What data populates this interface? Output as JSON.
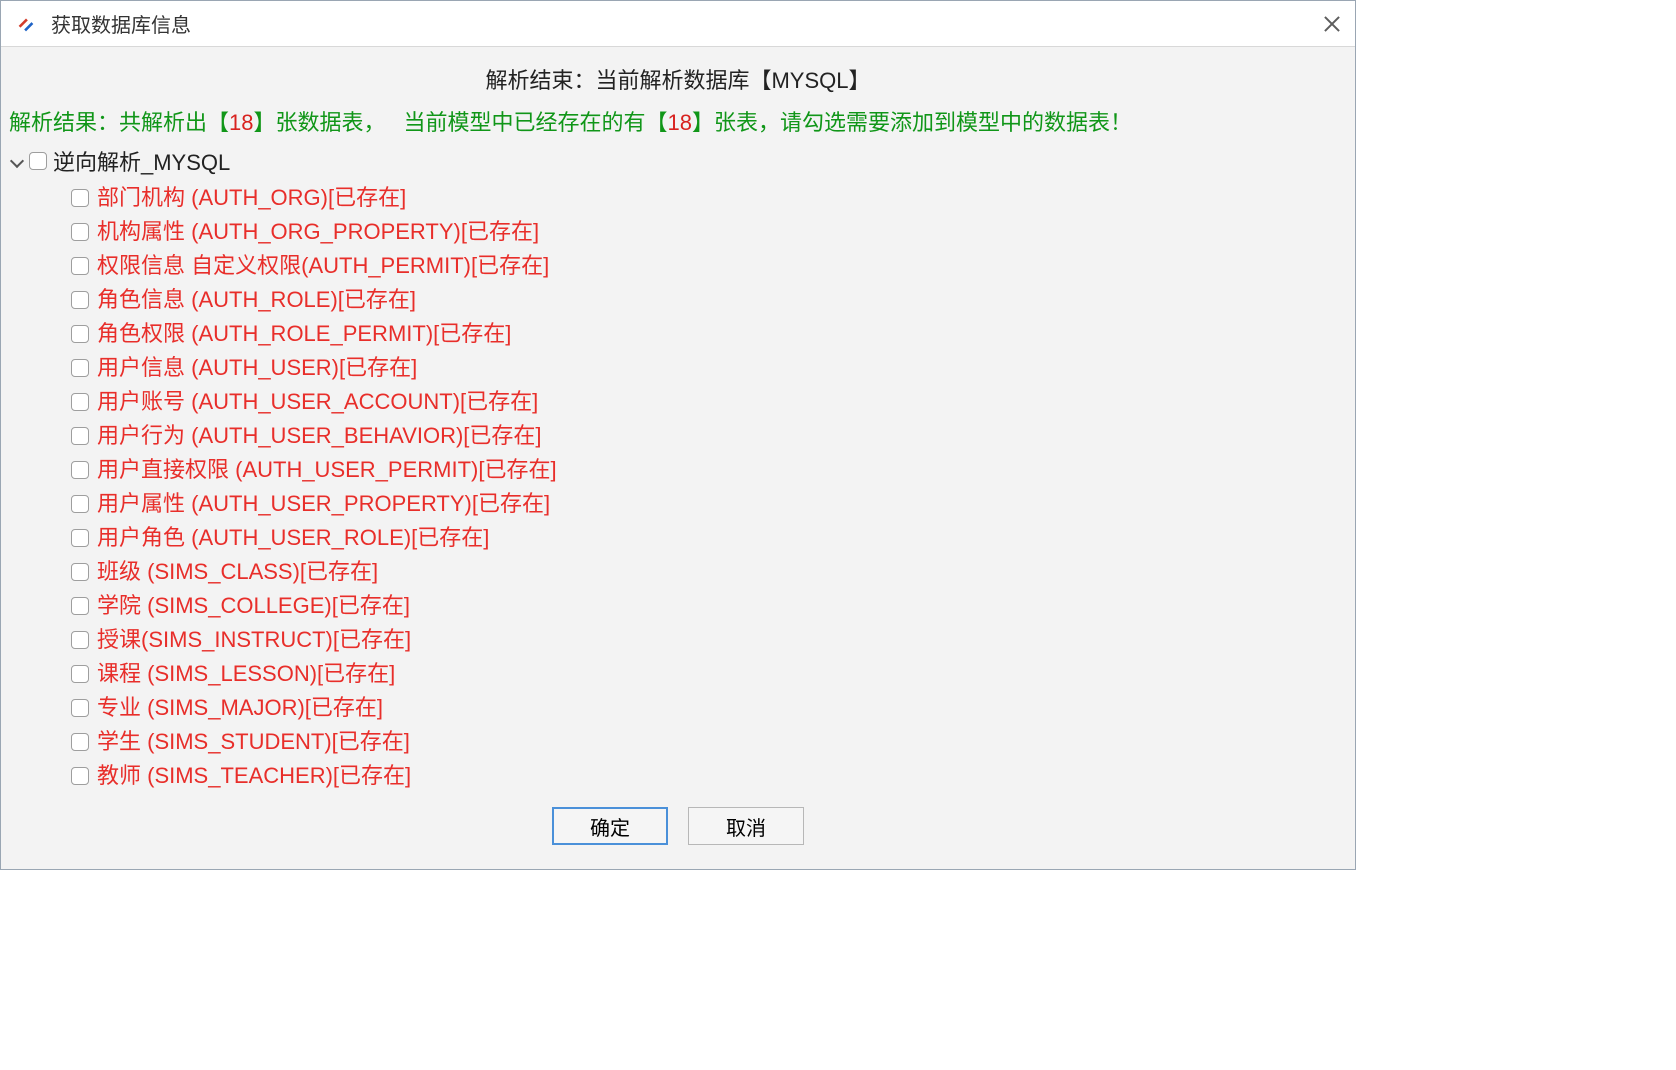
{
  "window": {
    "title": "获取数据库信息"
  },
  "header": {
    "parse_end_label": "解析结束：当前解析数据库【MYSQL】"
  },
  "summary": {
    "prefix": "解析结果：共解析出【",
    "count_parsed": "18",
    "mid1": "】张数据表，",
    "mid2": "当前模型中已经存在的有【",
    "count_exist": "18",
    "suffix": "】张表，请勾选需要添加到模型中的数据表！"
  },
  "tree": {
    "root_label": "逆向解析_MYSQL",
    "items": [
      "部门机构 (AUTH_ORG)[已存在]",
      "机构属性 (AUTH_ORG_PROPERTY)[已存在]",
      "权限信息 自定义权限(AUTH_PERMIT)[已存在]",
      "角色信息 (AUTH_ROLE)[已存在]",
      "角色权限 (AUTH_ROLE_PERMIT)[已存在]",
      "用户信息 (AUTH_USER)[已存在]",
      "用户账号 (AUTH_USER_ACCOUNT)[已存在]",
      "用户行为 (AUTH_USER_BEHAVIOR)[已存在]",
      "用户直接权限 (AUTH_USER_PERMIT)[已存在]",
      "用户属性 (AUTH_USER_PROPERTY)[已存在]",
      "用户角色 (AUTH_USER_ROLE)[已存在]",
      "班级 (SIMS_CLASS)[已存在]",
      "学院 (SIMS_COLLEGE)[已存在]",
      "授课(SIMS_INSTRUCT)[已存在]",
      "课程 (SIMS_LESSON)[已存在]",
      "专业 (SIMS_MAJOR)[已存在]",
      "学生 (SIMS_STUDENT)[已存在]",
      "教师 (SIMS_TEACHER)[已存在]"
    ]
  },
  "buttons": {
    "ok": "确定",
    "cancel": "取消"
  }
}
